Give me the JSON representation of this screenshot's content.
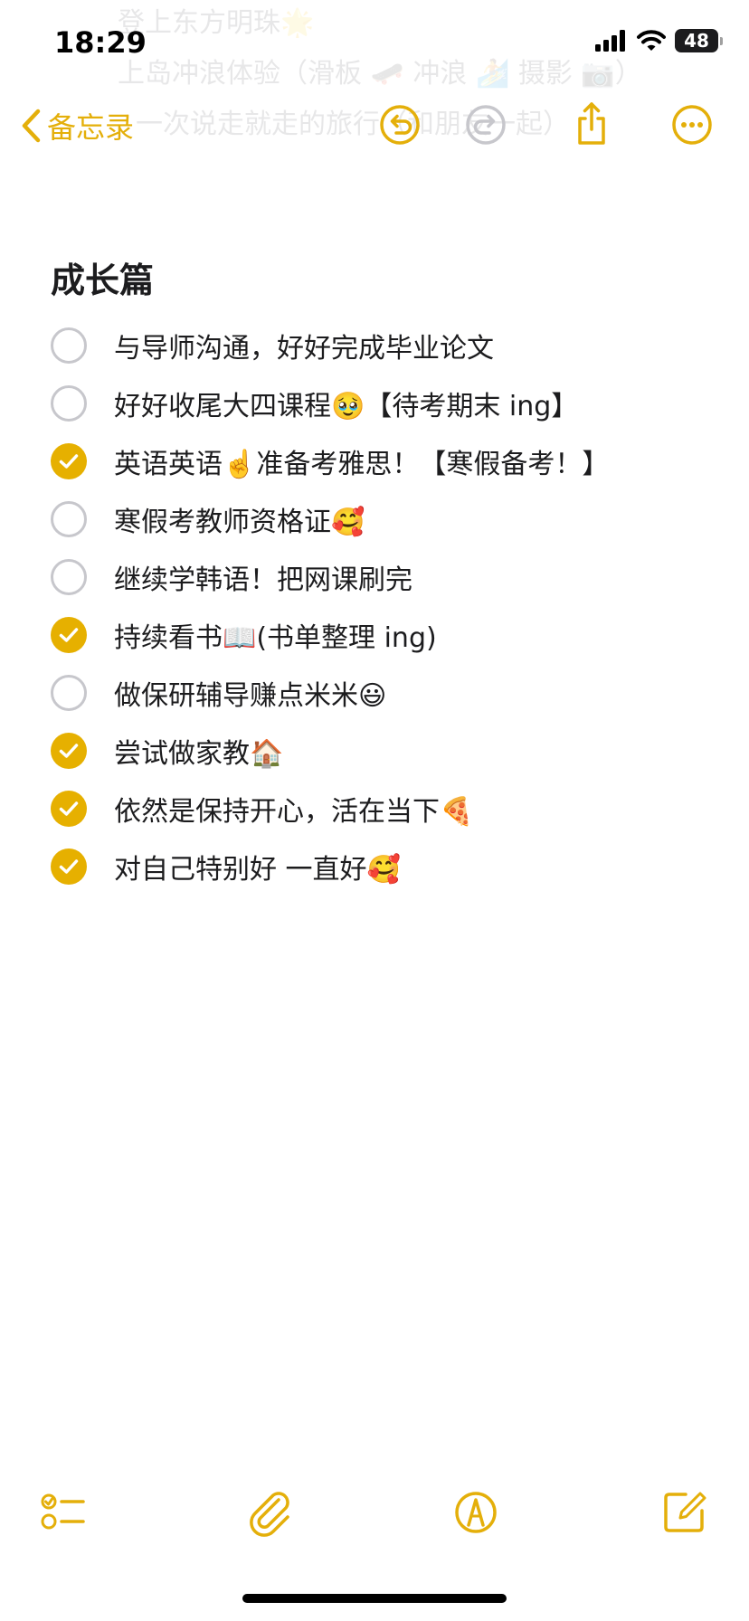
{
  "status_bar": {
    "time": "18:29",
    "battery_level": "48"
  },
  "background_ghost": [
    "登上东方明珠🌟",
    "上岛冲浪体验（滑板 🛹 冲浪 🏄 摄影 📷）",
    "一次说走就走的旅行（和朋友一起）"
  ],
  "nav": {
    "back_label": "备忘录",
    "icons": [
      "back-chevron-icon",
      "undo-icon",
      "redo-icon",
      "share-icon",
      "more-icon"
    ]
  },
  "note": {
    "title": "成长篇",
    "items": [
      {
        "text": "与导师沟通，好好完成毕业论文",
        "checked": false
      },
      {
        "text": "好好收尾大四课程🥹【待考期末 ing】",
        "checked": false
      },
      {
        "text": "英语英语☝️准备考雅思！【寒假备考！】",
        "checked": true
      },
      {
        "text": "寒假考教师资格证🥰",
        "checked": false
      },
      {
        "text": "继续学韩语！把网课刷完",
        "checked": false
      },
      {
        "text": "持续看书📖(书单整理 ing)",
        "checked": true
      },
      {
        "text": "做保研辅导赚点米米😃",
        "checked": false
      },
      {
        "text": "尝试做家教🏠",
        "checked": true
      },
      {
        "text": "依然是保持开心，活在当下🍕",
        "checked": true
      },
      {
        "text": "对自己特别好 一直好🥰",
        "checked": true
      }
    ]
  },
  "toolbar": {
    "icons": [
      "checklist-icon",
      "attachment-icon",
      "markup-icon",
      "compose-icon"
    ]
  },
  "colors": {
    "accent": "#e6b000",
    "unchecked_ring": "#c7c7cc",
    "text": "#1c1c1e"
  }
}
